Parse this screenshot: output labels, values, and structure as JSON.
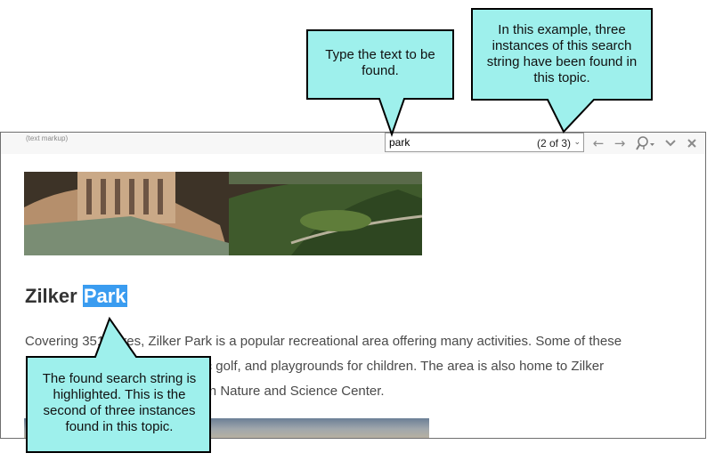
{
  "editor": {
    "markup_label": "(text markup)",
    "search": {
      "value": "park",
      "count": "(2 of 3)"
    },
    "toolbar_icons": [
      "arrow-left-icon",
      "arrow-right-icon",
      "highlight-icon",
      "chevron-down-icon",
      "close-icon"
    ]
  },
  "article": {
    "heading_prefix": "Zilker",
    "heading_highlight": "Park",
    "paragraph_line1": "Covering 351 acres, Zilker Park is a popular recreational area offering many activities. Some of these",
    "paragraph_line2": "include a botanical garden, disc golf, and playgrounds for children. The area is also home to Zilker",
    "paragraph_line3": "Botanical Garden and the Austin Nature and Science Center."
  },
  "callouts": {
    "type_text": "Type the text to be found.",
    "instances": "In this example, three instances of this search string have been found in this topic.",
    "highlighted": "The found search string is highlighted.  This is the second of three instances found in this topic."
  },
  "colors": {
    "callout_fill": "#9ef0ec",
    "highlight": "#3a9cf0"
  }
}
